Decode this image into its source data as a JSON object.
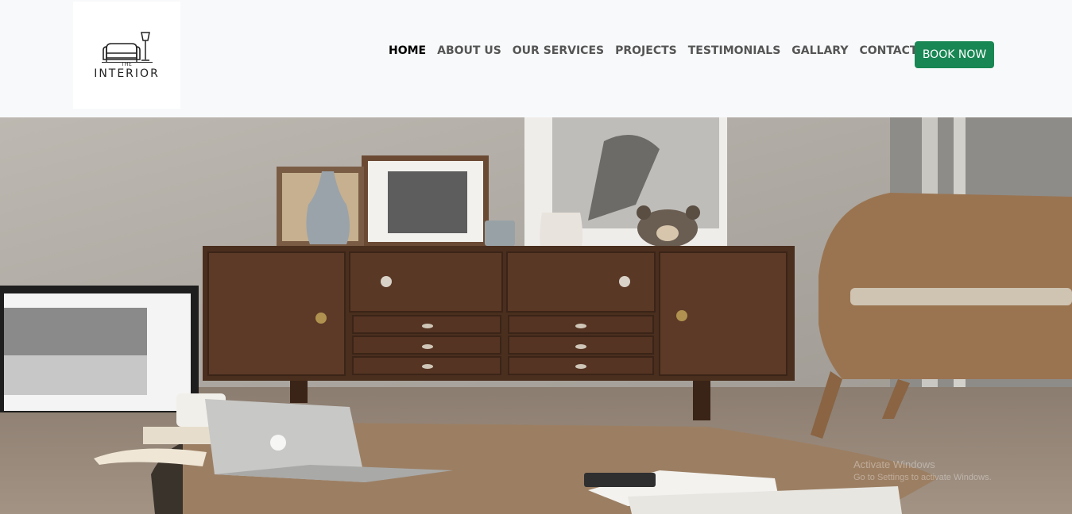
{
  "brand": {
    "logo_small": "THE",
    "logo_text": "INTERIOR",
    "logo_icon": "sofa-lamp-icon"
  },
  "nav": {
    "items": [
      {
        "label": "HOME",
        "active": true
      },
      {
        "label": "ABOUT US",
        "active": false
      },
      {
        "label": "OUR SERVICES",
        "active": false
      },
      {
        "label": "PROJECTS",
        "active": false
      },
      {
        "label": "TESTIMONIALS",
        "active": false
      },
      {
        "label": "GALLARY",
        "active": false
      },
      {
        "label": "CONTACT US",
        "active": false
      }
    ],
    "book_label": "BOOK NOW"
  },
  "hero": {
    "image": "living-room-interior-photo",
    "overlay_line1": "Activate Windows",
    "overlay_line2": "Go to Settings to activate Windows."
  },
  "colors": {
    "accent": "#198754",
    "navbar_bg": "#f8f9fa",
    "nav_text": "#555555",
    "nav_active": "#000000"
  }
}
